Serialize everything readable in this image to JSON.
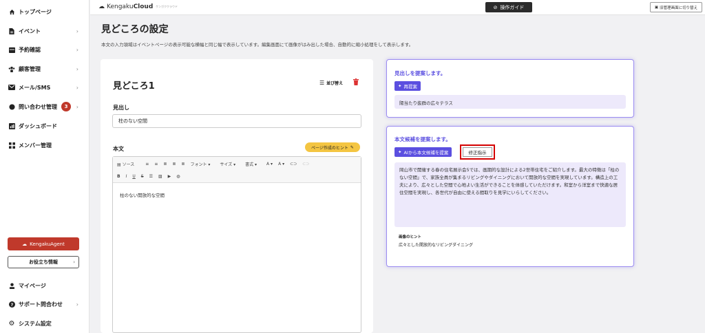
{
  "sidebar": {
    "items": [
      {
        "label": "トップページ",
        "icon": "home-icon"
      },
      {
        "label": "イベント",
        "icon": "document-icon"
      },
      {
        "label": "予約確認",
        "icon": "calendar-icon"
      },
      {
        "label": "顧客管理",
        "icon": "users-icon"
      },
      {
        "label": "メール/SMS",
        "icon": "mail-icon"
      },
      {
        "label": "問い合わせ管理",
        "icon": "chat-icon",
        "badge": "3"
      },
      {
        "label": "ダッシュボード",
        "icon": "chart-icon"
      },
      {
        "label": "メンバー管理",
        "icon": "grid-icon"
      }
    ],
    "agent_button": "KengakuAgent",
    "info_button": "お役立ち情報",
    "bottom_items": [
      {
        "label": "マイページ",
        "icon": "person-icon"
      },
      {
        "label": "サポート問合わせ",
        "icon": "help-icon"
      },
      {
        "label": "システム設定",
        "icon": "gear-icon"
      }
    ]
  },
  "header": {
    "logo_text": "Kengaku",
    "logo_bold": "Cloud",
    "logo_sub": "ケンガククラウド",
    "guide_button": "操作ガイド",
    "switch_button": "旧管理画面に切り替え"
  },
  "page": {
    "title": "見どころの設定",
    "description": "本文の入力領域はイベントページの表示可能な横幅と同じ幅で表示しています。編集画面にて画像がはみ出した場合、自動的に縮小処理をして表示します。"
  },
  "editor_panel": {
    "section_title": "見どころ1",
    "sort_label": "並び替え",
    "heading_label": "見出し",
    "heading_value": "柱のない空間",
    "body_label": "本文",
    "hint_button": "ページ作成のヒント",
    "toolbar_row1": [
      "ソース",
      "≡",
      "≡",
      "≣",
      "≣",
      "≣",
      "フォント ▾",
      "サイズ ▾",
      "書式 ▾",
      "A ▾",
      "A ▾"
    ],
    "toolbar_row2": [
      "B",
      "I",
      "U",
      "S"
    ],
    "body_text": "柱のない開放的な空間"
  },
  "suggest_heading": {
    "title": "見出しを提案します。",
    "button": "再提案",
    "value": "陽当たり抜群の広々テラス"
  },
  "suggest_body": {
    "title": "本文候補を提案します。",
    "ai_button": "AIから本文候補を提案",
    "fix_button": "修正指示",
    "text": "岡山市で開催する春の住宅展示会5では、画期的な設計による2世帯住宅をご紹介します。最大の特徴は「柱のない空間」で、家族全員が集まるリビングやダイニングにおいて開放的な空間を実現しています。構造上の工夫により、広々とした空間で心地よい生活ができることを体感していただけます。和室から洋室まで快適な居住空間を実現し、各世代が自由に使える間取りを見学にいらしてください。",
    "image_hint_label": "画像のヒント",
    "image_hint_value": "広々とした開放的なリビングダイニング"
  }
}
